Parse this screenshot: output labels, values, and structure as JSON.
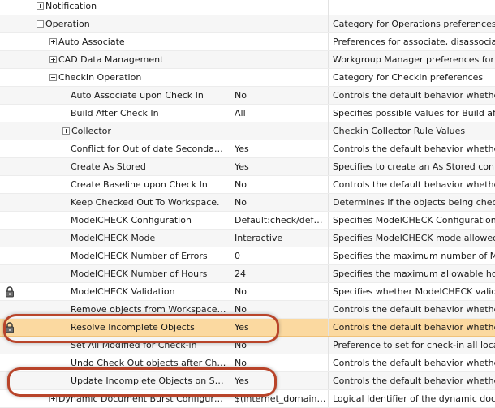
{
  "preferences": [
    {
      "name": "Notification",
      "value": "",
      "description": "",
      "level": 2,
      "toggle": "plus"
    },
    {
      "name": "Operation",
      "value": "",
      "description": "Category for Operations preferences",
      "level": 2,
      "toggle": "minus"
    },
    {
      "name": "Auto Associate",
      "value": "",
      "description": "Preferences for associate, disassociate a",
      "level": 3,
      "toggle": "plus"
    },
    {
      "name": "CAD Data Management",
      "value": "",
      "description": "Workgroup Manager preferences for th",
      "level": 3,
      "toggle": "plus"
    },
    {
      "name": "CheckIn Operation",
      "value": "",
      "description": "Category for CheckIn preferences",
      "level": 3,
      "toggle": "minus"
    },
    {
      "name": "Auto Associate upon Check In",
      "value": "No",
      "description": "Controls the default behavior whether",
      "level": 4
    },
    {
      "name": "Build After Check In",
      "value": "All",
      "description": "Specifies possible values for Build after",
      "level": 4
    },
    {
      "name": "Collector",
      "value": "",
      "description": "Checkin Collector Rule Values",
      "level": 4,
      "toggle": "plus"
    },
    {
      "name": "Conflict for Out of date Secondary c...",
      "value": "Yes",
      "description": "Controls the default behavior whether",
      "level": 4
    },
    {
      "name": "Create As Stored",
      "value": "Yes",
      "description": "Specifies to create an As Stored configu",
      "level": 4
    },
    {
      "name": "Create Baseline upon Check In",
      "value": "No",
      "description": "Controls the default behavior whether",
      "level": 4
    },
    {
      "name": "Keep Checked Out To Workspace.",
      "value": "No",
      "description": "Determines if the objects being checked",
      "level": 4
    },
    {
      "name": "ModelCHECK Configuration",
      "value": "Default:check/defaul...",
      "description": "Specifies ModelCHECK Configuration fi",
      "level": 4
    },
    {
      "name": "ModelCHECK Mode",
      "value": "Interactive",
      "description": "Specifies ModelCHECK mode allowed fo",
      "level": 4
    },
    {
      "name": "ModelCHECK Number of Errors",
      "value": "0",
      "description": "Specifies the maximum number of Mod",
      "level": 4
    },
    {
      "name": "ModelCHECK Number of Hours",
      "value": "24",
      "description": "Specifies the maximum allowable hours",
      "level": 4
    },
    {
      "name": "ModelCHECK Validation",
      "value": "No",
      "description": "Specifies whether ModelCHECK validatio",
      "level": 4,
      "locked": true
    },
    {
      "name": "Remove objects from Workspace afte...",
      "value": "No",
      "description": "Controls the default behavior whether",
      "level": 4
    },
    {
      "name": "Resolve Incomplete Objects",
      "value": "Yes",
      "description": "Controls the default behavior whether",
      "level": 4,
      "locked": true,
      "selected": true,
      "circled": true
    },
    {
      "name": "Set All Modified for Check-in",
      "value": "No",
      "description": "Preference to set for check-in all locally",
      "level": 4
    },
    {
      "name": "Undo Check Out objects after Check...",
      "value": "No",
      "description": "Controls the default behavior whether",
      "level": 4
    },
    {
      "name": "Update Incomplete Objects on Server",
      "value": "Yes",
      "description": "Controls the default behavior whether",
      "level": 4,
      "circled": true
    },
    {
      "name": "Dynamic Document Burst Configuration...",
      "value": "$(internet_domain_n...",
      "description": "Logical Identifier of the dynamic docum",
      "level": 3,
      "toggle": "plus"
    }
  ],
  "colors": {
    "selected_row": "#fbd9a0",
    "alternate_row": "#f6f6f6",
    "annotation_oval": "#b8442a"
  },
  "icons": {
    "expand": "plus-box-icon",
    "collapse": "minus-box-icon",
    "locked": "padlock-icon"
  }
}
